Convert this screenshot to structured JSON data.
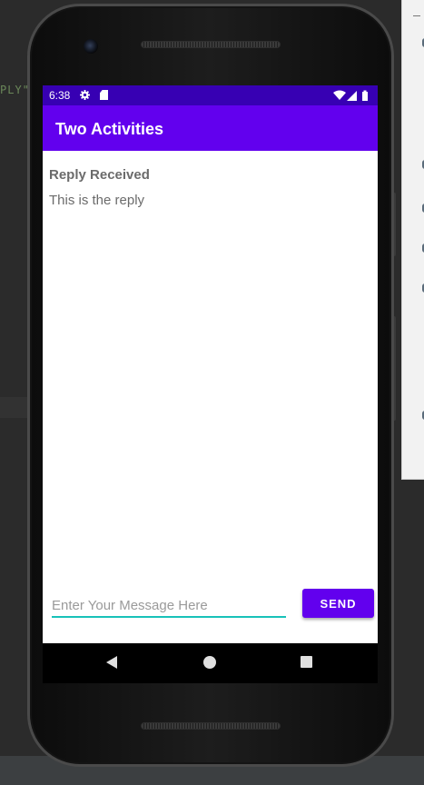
{
  "ide": {
    "code_fragment": "PLY\""
  },
  "device": {
    "status_bar": {
      "time": "6:38",
      "icons": [
        "gear-icon",
        "sd-card-icon",
        "wifi-icon",
        "signal-icon",
        "battery-icon"
      ]
    },
    "app_bar": {
      "title": "Two Activities"
    },
    "content": {
      "reply_header": "Reply Received",
      "reply_text": "This is the reply"
    },
    "message_input": {
      "value": "",
      "placeholder": "Enter Your Message Here"
    },
    "send_button": {
      "label": "SEND"
    },
    "nav_bar": {
      "icons": [
        "back-icon",
        "home-icon",
        "recents-icon"
      ]
    }
  },
  "colors": {
    "primary": "#6200ee",
    "primary_dark": "#3700b3",
    "accent": "#18c2b9"
  }
}
